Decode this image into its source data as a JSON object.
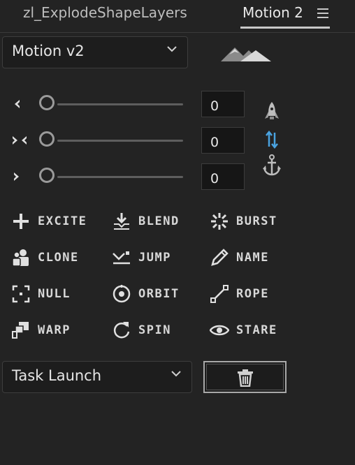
{
  "tabs": {
    "left": "zl_ExplodeShapeLayers",
    "right": "Motion 2"
  },
  "preset_select": {
    "value": "Motion v2"
  },
  "sliders": [
    {
      "icon": "chevron-left-icon",
      "value": "0"
    },
    {
      "icon": "collapse-arrows-icon",
      "value": "0"
    },
    {
      "icon": "chevron-right-icon",
      "value": "0"
    }
  ],
  "tools": {
    "excite": "EXCITE",
    "blend": "BLEND",
    "burst": "BURST",
    "clone": "CLONE",
    "jump": "JUMP",
    "name": "NAME",
    "null": "NULL",
    "orbit": "ORBIT",
    "rope": "ROPE",
    "warp": "WARP",
    "spin": "SPIN",
    "stare": "STARE"
  },
  "task_select": {
    "value": "Task Launch"
  },
  "colors": {
    "accent_blue": "#4aa3e0",
    "background": "#232323"
  }
}
